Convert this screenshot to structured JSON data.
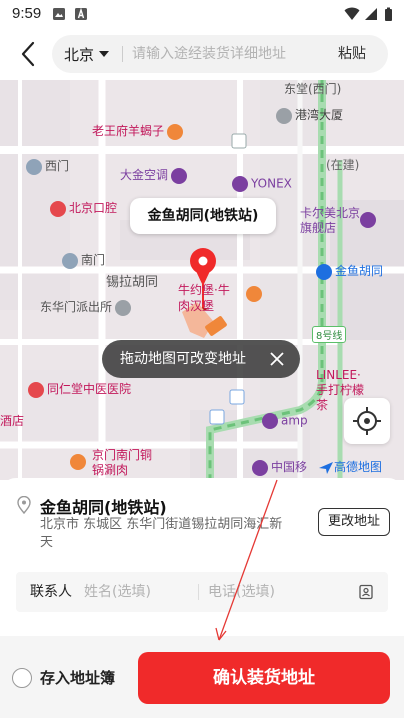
{
  "status_bar": {
    "time": "9:59"
  },
  "header": {
    "city": "北京",
    "search_placeholder": "请输入途经装货详细地址",
    "paste_label": "粘贴"
  },
  "map": {
    "selected_label": "金鱼胡同(地铁站)",
    "tip_text": "拖动地图可改变地址",
    "brand": "高德地图",
    "pois": [
      "东堂(西门)",
      "港湾大厦",
      "老王府羊蝎子",
      "西门",
      "(在建)",
      "大金空调",
      "YONEX",
      "北京口腔",
      "卡尔美北京旗舰店",
      "南门",
      "锡拉胡同",
      "金鱼胡同",
      "东华门派出所",
      "牛约堡·牛肉汉堡",
      "8号线",
      "同仁堂中医医院",
      "LINLEE·手打柠檬茶",
      "酒店",
      "amp",
      "京门南门铜锅涮肉",
      "中国移"
    ]
  },
  "address": {
    "title": "金鱼胡同(地铁站)",
    "detail": "北京市 东城区 东华门街道锡拉胡同海汇新天",
    "change_label": "更改地址"
  },
  "contact": {
    "label": "联系人",
    "name_placeholder": "姓名(选填)",
    "phone_placeholder": "电话(选填)"
  },
  "footer": {
    "save_label": "存入地址簿",
    "confirm_label": "确认装货地址"
  },
  "colors": {
    "primary_red": "#f02a2a",
    "map_bg": "#ede8ea",
    "poi_pink": "#c2185b",
    "poi_purple": "#7b3fa0",
    "metro_blue": "#1e6fe0",
    "metro_green": "#5cbf6a"
  }
}
